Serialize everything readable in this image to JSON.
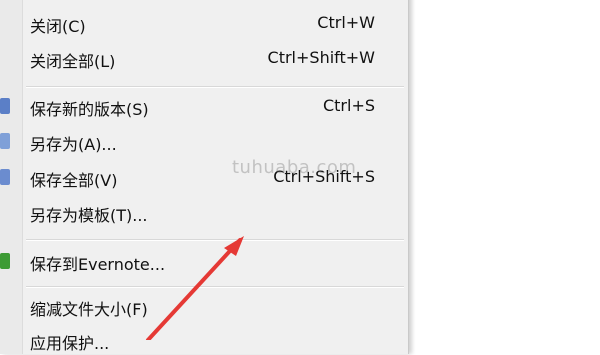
{
  "menu": {
    "items": [
      {
        "label": "关闭(C)",
        "shortcut": "Ctrl+W"
      },
      {
        "label": "关闭全部(L)",
        "shortcut": "Ctrl+Shift+W"
      },
      {
        "label": "保存新的版本(S)",
        "shortcut": "Ctrl+S",
        "icon": "save-version-icon"
      },
      {
        "label": "另存为(A)...",
        "shortcut": "",
        "icon": "save-as-icon"
      },
      {
        "label": "保存全部(V)",
        "shortcut": "Ctrl+Shift+S",
        "icon": "save-all-icon"
      },
      {
        "label": "另存为模板(T)...",
        "shortcut": ""
      },
      {
        "label": "保存到Evernote...",
        "shortcut": "",
        "icon": "evernote-icon"
      },
      {
        "label": "缩减文件大小(F)",
        "shortcut": ""
      },
      {
        "label": "应用保护...",
        "shortcut": ""
      }
    ]
  },
  "watermark": "tuhuaba.com",
  "colors": {
    "menu_background": "#f0f0f0",
    "arrow": "#e53935",
    "save_icon": "#5b7fc7",
    "evernote_icon": "#3d9b35"
  }
}
